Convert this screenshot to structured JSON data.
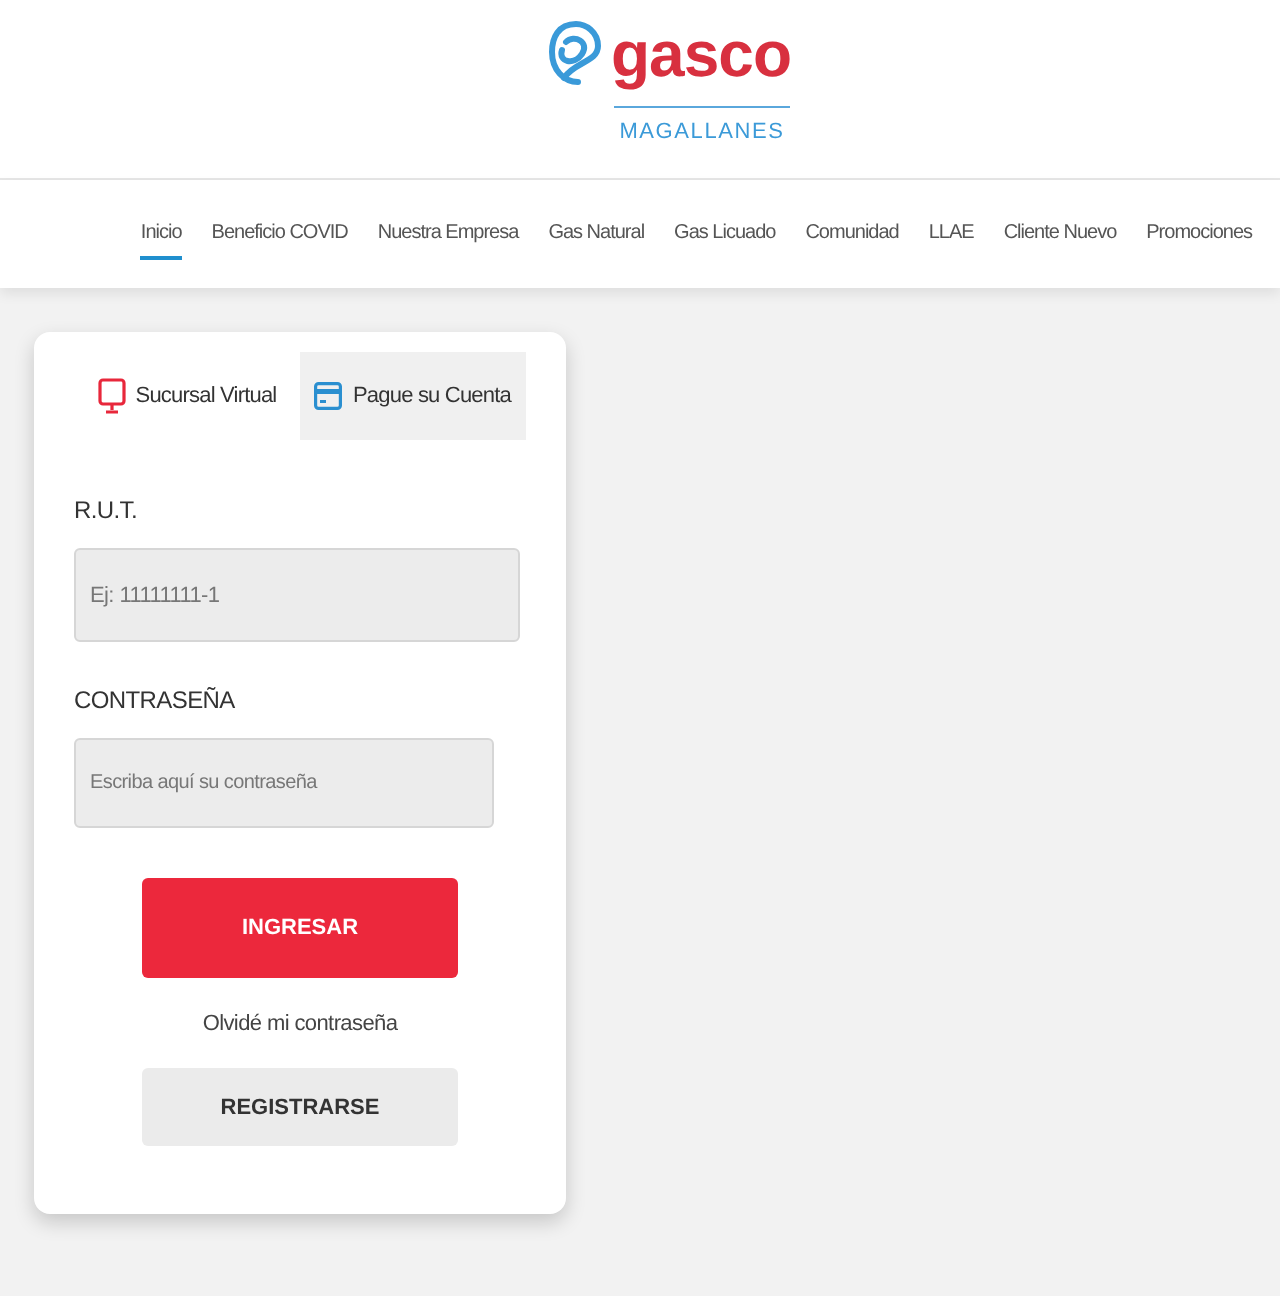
{
  "logo": {
    "name": "gasco",
    "region": "MAGALLANES"
  },
  "nav": [
    {
      "label": "Inicio",
      "selected": true
    },
    {
      "label": "Beneficio COVID",
      "selected": false
    },
    {
      "label": "Nuestra Empresa",
      "selected": false
    },
    {
      "label": "Gas Natural",
      "selected": false
    },
    {
      "label": "Gas Licuado",
      "selected": false
    },
    {
      "label": "Comunidad",
      "selected": false
    },
    {
      "label": "LLAE",
      "selected": false
    },
    {
      "label": "Cliente Nuevo",
      "selected": false
    },
    {
      "label": "Promociones",
      "selected": false
    }
  ],
  "login": {
    "tabs": [
      {
        "label": "Sucursal Virtual",
        "kind": "monitor",
        "selected": true
      },
      {
        "label": "Pague su Cuenta",
        "kind": "card",
        "selected": false
      }
    ],
    "fields": [
      {
        "label": "R.U.T.",
        "placeholder": "Ej: 11111111-1"
      },
      {
        "label": "CONTRASEÑA",
        "placeholder": "Escriba aquí su contraseña"
      }
    ],
    "submit": "INGRESAR",
    "forgot": "Olvidé mi contraseña",
    "register": "REGISTRARSE"
  }
}
